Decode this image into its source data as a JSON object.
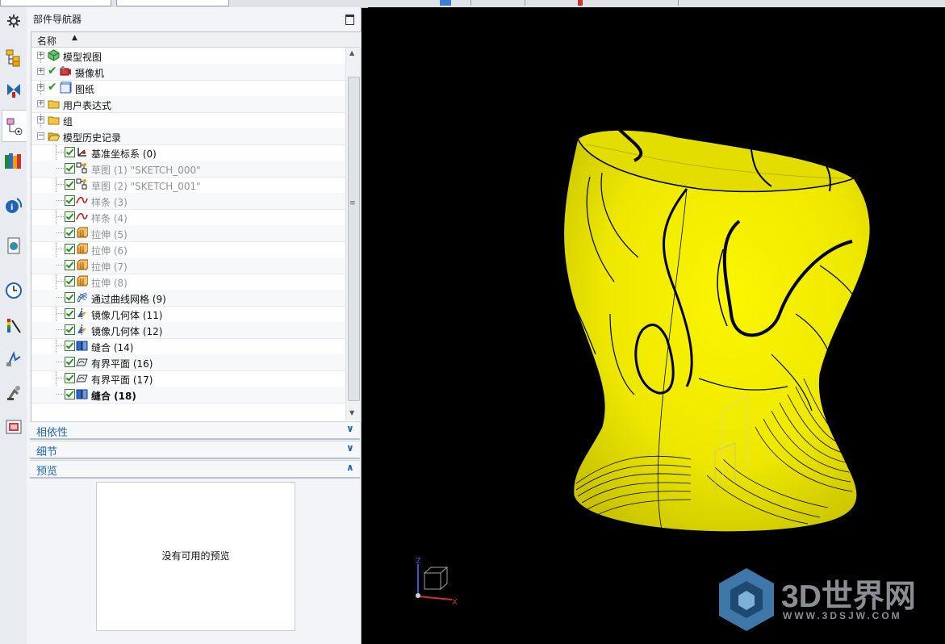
{
  "navigator": {
    "title": "部件导航器",
    "column_header": "名称",
    "tree": [
      {
        "label": "模型视图",
        "level": 0,
        "expander": "+",
        "icon": "model-views-icon"
      },
      {
        "label": "摄像机",
        "level": 0,
        "expander": "+",
        "icon": "camera-icon",
        "checked": true
      },
      {
        "label": "图纸",
        "level": 0,
        "expander": "+",
        "icon": "drawing-sheet-icon",
        "checked": true
      },
      {
        "label": "用户表达式",
        "level": 0,
        "expander": "+",
        "icon": "folder-icon"
      },
      {
        "label": "组",
        "level": 0,
        "expander": "+",
        "icon": "folder-icon"
      },
      {
        "label": "模型历史记录",
        "level": 0,
        "expander": "−",
        "icon": "folder-open-icon"
      },
      {
        "label": "基准坐标系 (0)",
        "level": 1,
        "icon": "datum-csys-icon",
        "checked": true,
        "dimmed": false
      },
      {
        "label": "草图 (1) \"SKETCH_000\"",
        "level": 1,
        "icon": "sketch-icon",
        "checked": true,
        "dimmed": true
      },
      {
        "label": "草图 (2) \"SKETCH_001\"",
        "level": 1,
        "icon": "sketch-icon",
        "checked": true,
        "dimmed": true
      },
      {
        "label": "样条 (3)",
        "level": 1,
        "icon": "spline-icon",
        "checked": true,
        "dimmed": true
      },
      {
        "label": "样条 (4)",
        "level": 1,
        "icon": "spline-icon",
        "checked": true,
        "dimmed": true
      },
      {
        "label": "拉伸 (5)",
        "level": 1,
        "icon": "extrude-icon",
        "checked": true,
        "dimmed": true
      },
      {
        "label": "拉伸 (6)",
        "level": 1,
        "icon": "extrude-icon",
        "checked": true,
        "dimmed": true
      },
      {
        "label": "拉伸 (7)",
        "level": 1,
        "icon": "extrude-icon",
        "checked": true,
        "dimmed": true
      },
      {
        "label": "拉伸 (8)",
        "level": 1,
        "icon": "extrude-icon",
        "checked": true,
        "dimmed": true
      },
      {
        "label": "通过曲线网格 (9)",
        "level": 1,
        "icon": "curve-mesh-icon",
        "checked": true,
        "dimmed": false
      },
      {
        "label": "镜像几何体 (11)",
        "level": 1,
        "icon": "mirror-geometry-icon",
        "checked": true,
        "dimmed": false
      },
      {
        "label": "镜像几何体 (12)",
        "level": 1,
        "icon": "mirror-geometry-icon",
        "checked": true,
        "dimmed": false
      },
      {
        "label": "缝合 (14)",
        "level": 1,
        "icon": "sew-icon",
        "checked": true,
        "dimmed": false
      },
      {
        "label": "有界平面 (16)",
        "level": 1,
        "icon": "bounded-plane-icon",
        "checked": true,
        "dimmed": false
      },
      {
        "label": "有界平面 (17)",
        "level": 1,
        "icon": "bounded-plane-icon",
        "checked": true,
        "dimmed": false
      },
      {
        "label": "缝合 (18)",
        "level": 1,
        "icon": "sew-icon",
        "checked": true,
        "dimmed": false,
        "bold": true
      }
    ]
  },
  "sections": {
    "dependencies": "相依性",
    "details": "细节",
    "preview": "预览",
    "preview_empty": "没有可用的预览"
  },
  "viewport": {
    "triad_axes": {
      "x": "X",
      "z": "Z"
    },
    "watermark": "3D世界网",
    "watermark_url": "WWW.3DSJW.COM",
    "model_color": "#f2f000"
  },
  "resource_bar": [
    "gear-icon",
    "assembly-navigator-icon",
    "constraint-navigator-icon",
    "part-navigator-icon",
    "reuse-library-icon",
    "hd3d-tools-icon",
    "web-browser-icon",
    "history-icon",
    "system-materials-icon",
    "process-studio-icon",
    "manufacturing-wizard-icon",
    "role-icon"
  ]
}
